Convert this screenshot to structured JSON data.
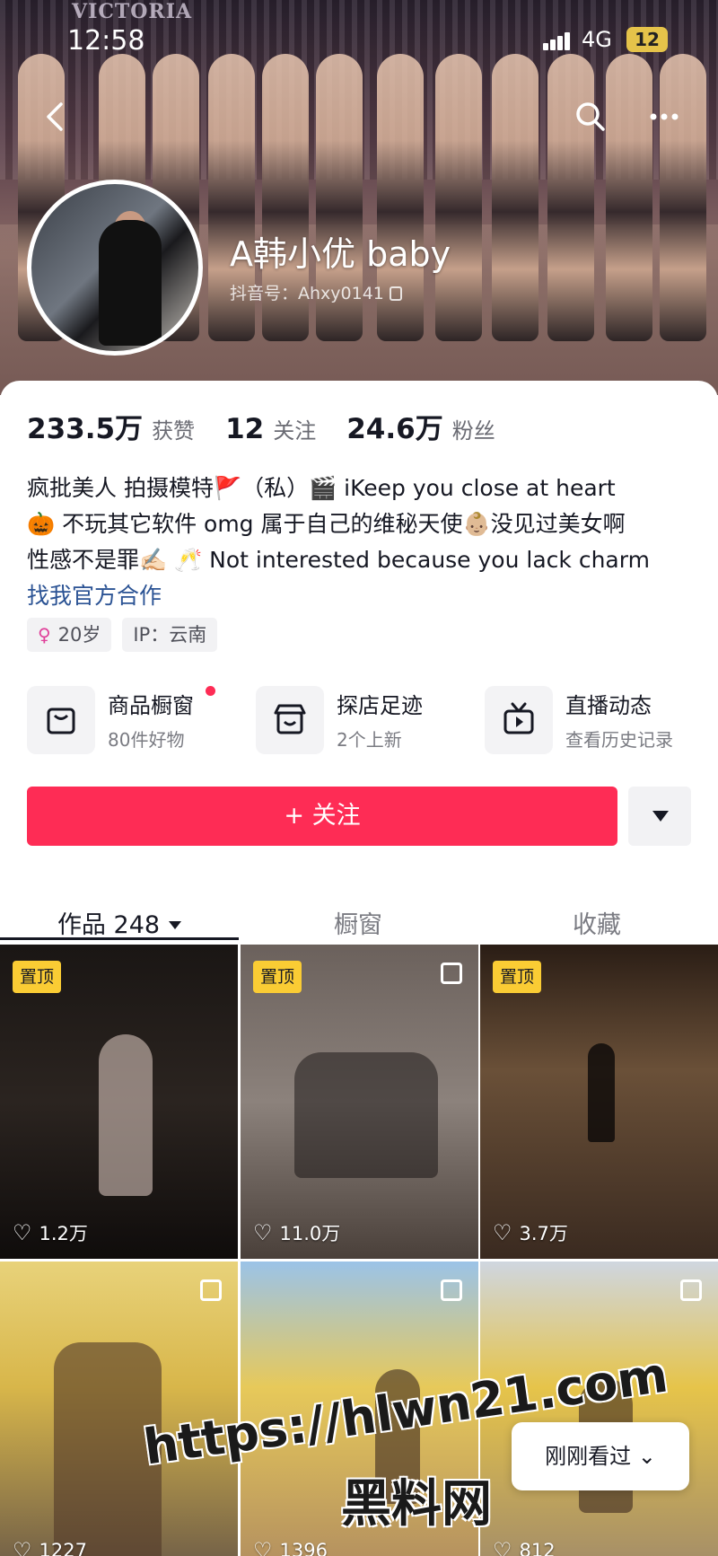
{
  "status_bar": {
    "time": "12:58",
    "network": "4G",
    "battery": "12"
  },
  "banner": {
    "brand_text": "VICTORIA"
  },
  "profile": {
    "nickname": "A韩小优 baby",
    "douyin_id": "抖音号：Ahxy0141",
    "stats": [
      {
        "value": "233.5万",
        "label": "获赞"
      },
      {
        "value": "12",
        "label": "关注"
      },
      {
        "value": "24.6万",
        "label": "粉丝"
      }
    ],
    "bio_lines": [
      "疯批美人 拍摄模特🚩（私）🎬 iKeep you close at heart",
      "🎃 不玩其它软件 omg 属于自己的维秘天使👶🏼没见过美女啊",
      "性感不是罪✍🏻 🥂 Not interested because you lack charm"
    ],
    "collab_link": "找我官方合作",
    "tags": [
      {
        "icon": "female-icon",
        "text": "20岁"
      },
      {
        "text": "IP：云南"
      }
    ]
  },
  "entries": [
    {
      "icon": "shopping-bag-icon",
      "title": "商品橱窗",
      "subtitle": "80件好物",
      "has_dot": true
    },
    {
      "icon": "store-icon",
      "title": "探店足迹",
      "subtitle": "2个上新"
    },
    {
      "icon": "live-tv-icon",
      "title": "直播动态",
      "subtitle": "查看历史记录"
    }
  ],
  "actions": {
    "follow_label": "+ 关注"
  },
  "tabs": [
    {
      "label": "作品 248",
      "active": true
    },
    {
      "label": "橱窗"
    },
    {
      "label": "收藏"
    }
  ],
  "videos": [
    {
      "badge": "置顶",
      "likes": "1.2万",
      "multi": false
    },
    {
      "badge": "置顶",
      "likes": "11.0万",
      "multi": true
    },
    {
      "badge": "置顶",
      "likes": "3.7万",
      "multi": false
    },
    {
      "likes": "1227",
      "multi": true
    },
    {
      "likes": "1396",
      "multi": true
    },
    {
      "likes": "812",
      "multi": true
    }
  ],
  "overlay": {
    "watermark_url": "https://hlwn21.com",
    "watermark_cn": "黑料网",
    "recent_pill": "刚刚看过 ⌄"
  },
  "colors": {
    "accent": "#fe2c55",
    "badge": "#facc34",
    "link": "#2b5394"
  }
}
